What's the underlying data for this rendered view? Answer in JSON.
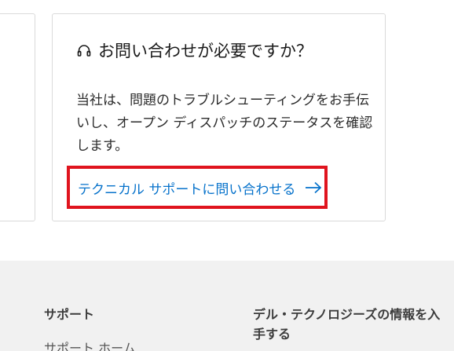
{
  "help_card": {
    "title": "お問い合わせが必要ですか？",
    "description": "当社は、問題のトラブルシューティングをお手伝いし、オープン ディスパッチのステータスを確認します。",
    "cta_label": "テクニカル サポートに問い合わせる",
    "title_icon": "headset-icon",
    "cta_icon": "arrow-right-icon",
    "link_color": "#0672cb",
    "highlight_color": "#e0141e"
  },
  "footer": {
    "support_heading": "サポート",
    "support_first_link": "サポート ホーム",
    "info_heading": "デル・テクノロジーズの情報を入手する"
  }
}
